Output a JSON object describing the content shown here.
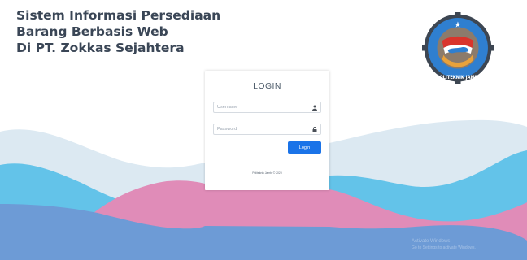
{
  "app": {
    "title_lines": [
      "Sistem Informasi Persediaan",
      "Barang Berbasis Web",
      "Di PT. Zokkas Sejahtera"
    ]
  },
  "logo": {
    "text": "POLITEKNIK JAMBI"
  },
  "login": {
    "title": "LOGIN",
    "username_placeholder": "Username",
    "password_placeholder": "Password",
    "button_label": "Login",
    "footer": "Politeknik Jambi © 2020"
  },
  "watermark": {
    "line1": "Activate Windows",
    "line2": "Go to Settings to activate Windows."
  },
  "colors": {
    "wave_back": "#dce9f2",
    "wave_light_blue": "#63c3e9",
    "wave_pink": "#e08cb8",
    "wave_dark_blue": "#6d9bd6",
    "button": "#1a73e8",
    "title_text": "#3a4656"
  },
  "icons": {
    "username": "user-icon",
    "password": "lock-icon"
  }
}
